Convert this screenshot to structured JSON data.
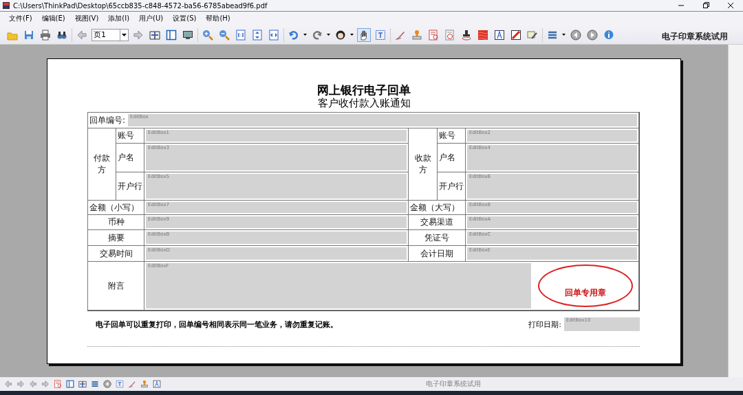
{
  "window": {
    "title": "C:\\Users\\ThinkPad\\Desktop\\65ccb835-c848-4572-ba56-6785abead9f6.pdf"
  },
  "menu": [
    "文件(F)",
    "编辑(E)",
    "视图(V)",
    "添加(I)",
    "用户(U)",
    "设置(S)",
    "帮助(H)"
  ],
  "toolbar": {
    "page_field": {
      "value": "页1"
    },
    "trial_label": "电子印章系统试用"
  },
  "document": {
    "title": "网上银行电子回单",
    "subtitle": "客户收付款入账通知",
    "number": {
      "label": "回单编号:",
      "field": "EditBox"
    },
    "payer": {
      "label": "付款方",
      "rows": [
        {
          "label": "账号",
          "field": "EditBox1"
        },
        {
          "label": "户名",
          "field": "EditBox3"
        },
        {
          "label": "开户行",
          "field": "EditBox5"
        }
      ]
    },
    "payee": {
      "label": "收款方",
      "rows": [
        {
          "label": "账号",
          "field": "EditBox2"
        },
        {
          "label": "户名",
          "field": "EditBox4"
        },
        {
          "label": "开户行",
          "field": "EditBox6"
        }
      ]
    },
    "pairs": [
      {
        "left": {
          "label": "金额（小写）",
          "field": "EditBox7"
        },
        "right": {
          "label": "金额（大写）",
          "field": "EditBox8"
        }
      },
      {
        "left": {
          "label": "币种",
          "field": "EditBox9"
        },
        "right": {
          "label": "交易渠道",
          "field": "EditBoxA"
        }
      },
      {
        "left": {
          "label": "摘要",
          "field": "EditBoxB"
        },
        "right": {
          "label": "凭证号",
          "field": "EditBoxC"
        }
      },
      {
        "left": {
          "label": "交易时间",
          "field": "EditBoxD"
        },
        "right": {
          "label": "会计日期",
          "field": "EditBoxE"
        }
      }
    ],
    "remark": {
      "label": "附言",
      "field": "EditBoxF"
    },
    "stamp": {
      "text": "回单专用章"
    },
    "note": "电子回单可以重复打印，回单编号相同表示同一笔业务，请勿重复记账。",
    "print_date": {
      "label": "打印日期:",
      "field": "EditBox10"
    }
  },
  "status_bar": {
    "text": "电子印章系统试用"
  }
}
